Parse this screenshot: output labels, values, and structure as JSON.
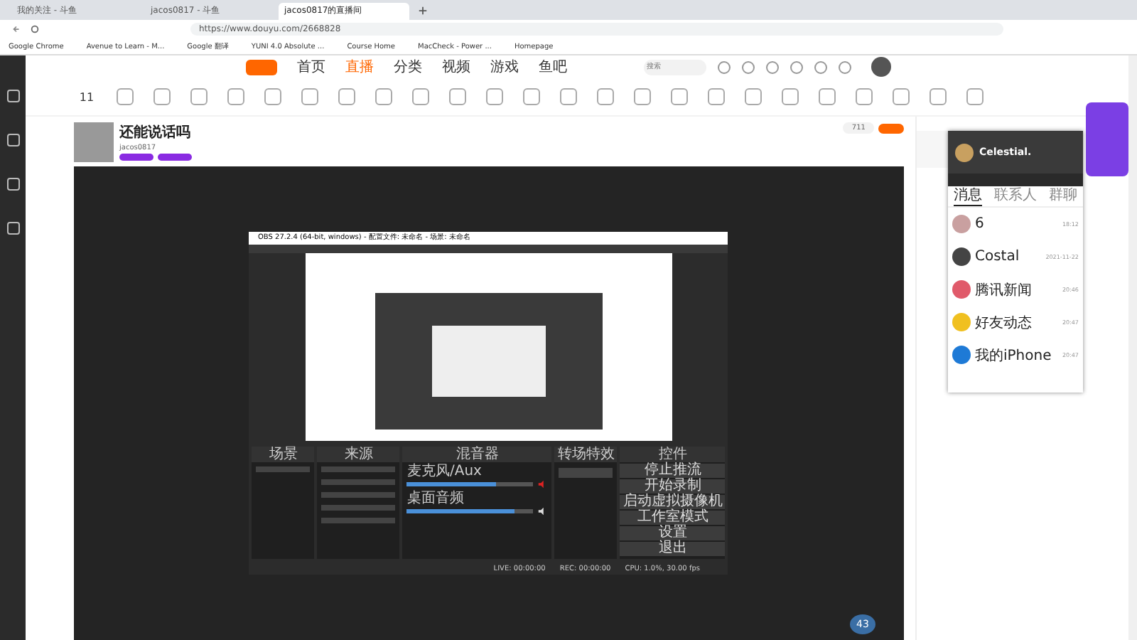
{
  "browser": {
    "tabs": [
      {
        "title": "我的关注 - 斗鱼",
        "selected": false
      },
      {
        "title": "jacos0817 - 斗鱼",
        "selected": false
      },
      {
        "title": "jacos0817的直播间",
        "selected": true
      }
    ],
    "url": "https://www.douyu.com/2668828",
    "bookmarks": [
      "Google Chrome",
      "Avenue to Learn - M...",
      "Google 翻译",
      "YUNI 4.0 Absolute ...",
      "Course Home",
      "MacCheck - Power ...",
      "Homepage"
    ]
  },
  "site": {
    "nav": [
      {
        "label": "首页",
        "selected": false
      },
      {
        "label": "直播",
        "selected": true
      },
      {
        "label": "分类",
        "selected": false
      },
      {
        "label": "视频",
        "selected": false
      },
      {
        "label": "游戏",
        "selected": false
      },
      {
        "label": "鱼吧",
        "selected": false
      }
    ],
    "search": {
      "placeholder": "搜索"
    },
    "level_count": "11",
    "streamer": {
      "name": "还能说话吗",
      "id": "jacos0817"
    },
    "follow_count": "711"
  },
  "obs": {
    "title": "OBS 27.2.4 (64-bit, windows) - 配置文件: 未命名 - 场景: 未命名",
    "panels": [
      {
        "kind": "scenes",
        "title": "场景"
      },
      {
        "kind": "sources",
        "title": "来源"
      },
      {
        "kind": "mixer",
        "title": "混音器"
      },
      {
        "kind": "transitions",
        "title": "转场特效"
      },
      {
        "kind": "controls",
        "title": "控件"
      }
    ],
    "controls": [
      "停止推流",
      "开始录制",
      "启动虚拟摄像机",
      "工作室模式",
      "设置",
      "退出"
    ],
    "mixer": [
      {
        "name": "麦克风/Aux",
        "level": 0.7,
        "muted": true
      },
      {
        "name": "桌面音频",
        "level": 0.85,
        "muted": false
      }
    ],
    "status": [
      "LIVE: 00:00:00",
      "REC: 00:00:00",
      "CPU: 1.0%, 30.00 fps"
    ]
  },
  "qq": {
    "name": "Celestial.",
    "tabs": [
      {
        "label": "消息",
        "selected": true
      },
      {
        "label": "联系人",
        "selected": false
      },
      {
        "label": "群聊",
        "selected": false
      }
    ],
    "contacts": [
      {
        "name": "6",
        "time": "18:12",
        "color": "#c9a0a0"
      },
      {
        "name": "Costal",
        "time": "2021-11-22",
        "color": "#444444"
      },
      {
        "name": "腾讯新闻",
        "time": "20:46",
        "color": "#e05a6a"
      },
      {
        "name": "好友动态",
        "time": "20:47",
        "color": "#f0c020"
      },
      {
        "name": "我的iPhone",
        "time": "20:47",
        "color": "#1e7ad6"
      }
    ]
  },
  "perf_badge": "43"
}
